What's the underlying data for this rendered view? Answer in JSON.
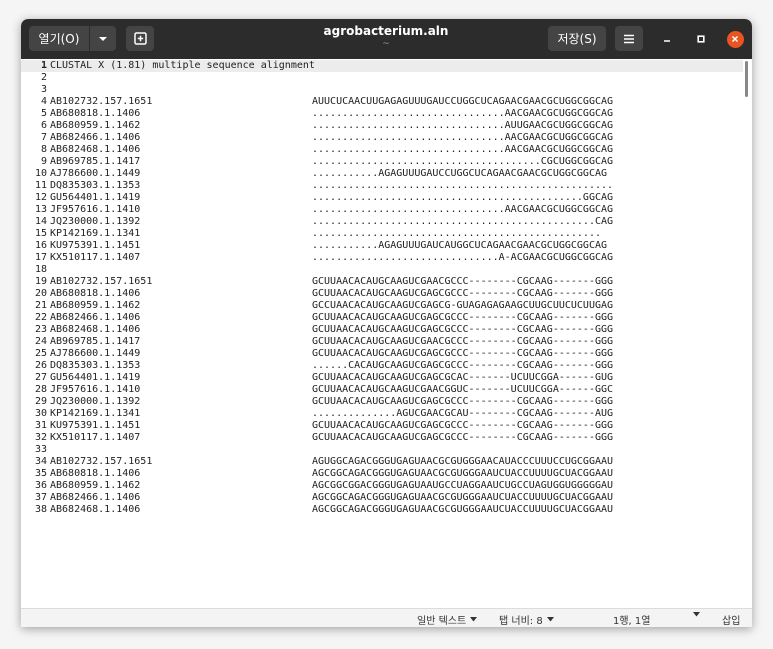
{
  "header": {
    "open_label": "열기(O)",
    "save_label": "저장(S)",
    "title": "agrobacterium.aln",
    "subtitle": "~"
  },
  "status": {
    "language": "일반 텍스트",
    "tab_width": "탭 너비: 8",
    "position": "1행, 1열",
    "insert_mode": "삽입"
  },
  "editor": {
    "current_line": 1,
    "lines": [
      {
        "n": "1",
        "name": "CLUSTAL X (1.81) multiple sequence alignment",
        "seq": ""
      },
      {
        "n": "2",
        "name": "",
        "seq": ""
      },
      {
        "n": "3",
        "name": "",
        "seq": ""
      },
      {
        "n": "4",
        "name": "AB102732.157.1651",
        "seq": "AUUCUCAACUUGAGAGUUUGAUCCUGGCUCAGAACGAACGCUGGCGGCAG"
      },
      {
        "n": "5",
        "name": "AB680818.1.1406",
        "seq": "................................AACGAACGCUGGCGGCAG"
      },
      {
        "n": "6",
        "name": "AB680959.1.1462",
        "seq": "................................AUUGAACGCUGGCGGCAG"
      },
      {
        "n": "7",
        "name": "AB682466.1.1406",
        "seq": "................................AACGAACGCUGGCGGCAG"
      },
      {
        "n": "8",
        "name": "AB682468.1.1406",
        "seq": "................................AACGAACGCUGGCGGCAG"
      },
      {
        "n": "9",
        "name": "AB969785.1.1417",
        "seq": "......................................CGCUGGCGGCAG"
      },
      {
        "n": "10",
        "name": "AJ786600.1.1449",
        "seq": "...........AGAGUUUGAUCCUGGCUCAGAACGAACGCUGGCGGCAG"
      },
      {
        "n": "11",
        "name": "DQ835303.1.1353",
        "seq": ".................................................."
      },
      {
        "n": "12",
        "name": "GU564401.1.1419",
        "seq": ".............................................GGCAG"
      },
      {
        "n": "13",
        "name": "JF957616.1.1410",
        "seq": "................................AACGAACGCUGGCGGCAG"
      },
      {
        "n": "14",
        "name": "JQ230000.1.1392",
        "seq": "...............................................CAG"
      },
      {
        "n": "15",
        "name": "KP142169.1.1341",
        "seq": "................................................"
      },
      {
        "n": "16",
        "name": "KU975391.1.1451",
        "seq": "...........AGAGUUUGAUCAUGGCUCAGAACGAACGCUGGCGGCAG"
      },
      {
        "n": "17",
        "name": "KX510117.1.1407",
        "seq": "...............................A-ACGAACGCUGGCGGCAG"
      },
      {
        "n": "18",
        "name": "",
        "seq": ""
      },
      {
        "n": "19",
        "name": "AB102732.157.1651",
        "seq": "GCUUAACACAUGCAAGUCGAACGCCC--------CGCAAG-------GGG"
      },
      {
        "n": "20",
        "name": "AB680818.1.1406",
        "seq": "GCUUAACACAUGCAAGUCGAGCGCCC--------CGCAAG-------GGG"
      },
      {
        "n": "21",
        "name": "AB680959.1.1462",
        "seq": "GCCUAACACAUGCAAGUCGAGCG-GUAGAGAGAAGCUUGCUUCUCUUGAG"
      },
      {
        "n": "22",
        "name": "AB682466.1.1406",
        "seq": "GCUUAACACAUGCAAGUCGAGCGCCC--------CGCAAG-------GGG"
      },
      {
        "n": "23",
        "name": "AB682468.1.1406",
        "seq": "GCUUAACACAUGCAAGUCGAGCGCCC--------CGCAAG-------GGG"
      },
      {
        "n": "24",
        "name": "AB969785.1.1417",
        "seq": "GCUUAACACAUGCAAGUCGAACGCCC--------CGCAAG-------GGG"
      },
      {
        "n": "25",
        "name": "AJ786600.1.1449",
        "seq": "GCUUAACACAUGCAAGUCGAGCGCCC--------CGCAAG-------GGG"
      },
      {
        "n": "26",
        "name": "DQ835303.1.1353",
        "seq": "......CACAUGCAAGUCGAGCGCCC--------CGCAAG-------GGG"
      },
      {
        "n": "27",
        "name": "GU564401.1.1419",
        "seq": "GCUUAACACAUGCAAGUCGAGCGCAC-------UCUUCGGA------GUG"
      },
      {
        "n": "28",
        "name": "JF957616.1.1410",
        "seq": "GCUUAACACAUGCAAGUCGAACGGUC-------UCUUCGGA------GGC"
      },
      {
        "n": "29",
        "name": "JQ230000.1.1392",
        "seq": "GCUUAACACAUGCAAGUCGAGCGCCC--------CGCAAG-------GGG"
      },
      {
        "n": "30",
        "name": "KP142169.1.1341",
        "seq": "..............AGUCGAACGCAU--------CGCAAG-------AUG"
      },
      {
        "n": "31",
        "name": "KU975391.1.1451",
        "seq": "GCUUAACACAUGCAAGUCGAGCGCCC--------CGCAAG-------GGG"
      },
      {
        "n": "32",
        "name": "KX510117.1.1407",
        "seq": "GCUUAACACAUGCAAGUCGAGCGCCC--------CGCAAG-------GGG"
      },
      {
        "n": "33",
        "name": "",
        "seq": ""
      },
      {
        "n": "34",
        "name": "AB102732.157.1651",
        "seq": "AGUGGCAGACGGGUGAGUAACGCGUGGGAACAUACCCUUUCCUGCGGAAU"
      },
      {
        "n": "35",
        "name": "AB680818.1.1406",
        "seq": "AGCGGCAGACGGGUGAGUAACGCGUGGGAAUCUACCUUUUGCUACGGAAU"
      },
      {
        "n": "36",
        "name": "AB680959.1.1462",
        "seq": "AGCGGCGGACGGGUGAGUAAUGCCUAGGAAUCUGCCUAGUGGUGGGGGAU"
      },
      {
        "n": "37",
        "name": "AB682466.1.1406",
        "seq": "AGCGGCAGACGGGUGAGUAACGCGUGGGAAUCUACCUUUUGCUACGGAAU"
      },
      {
        "n": "38",
        "name": "AB682468.1.1406",
        "seq": "AGCGGCAGACGGGUGAGUAACGCGUGGGAAUCUACCUUUUGCUACGGAAU"
      }
    ]
  }
}
